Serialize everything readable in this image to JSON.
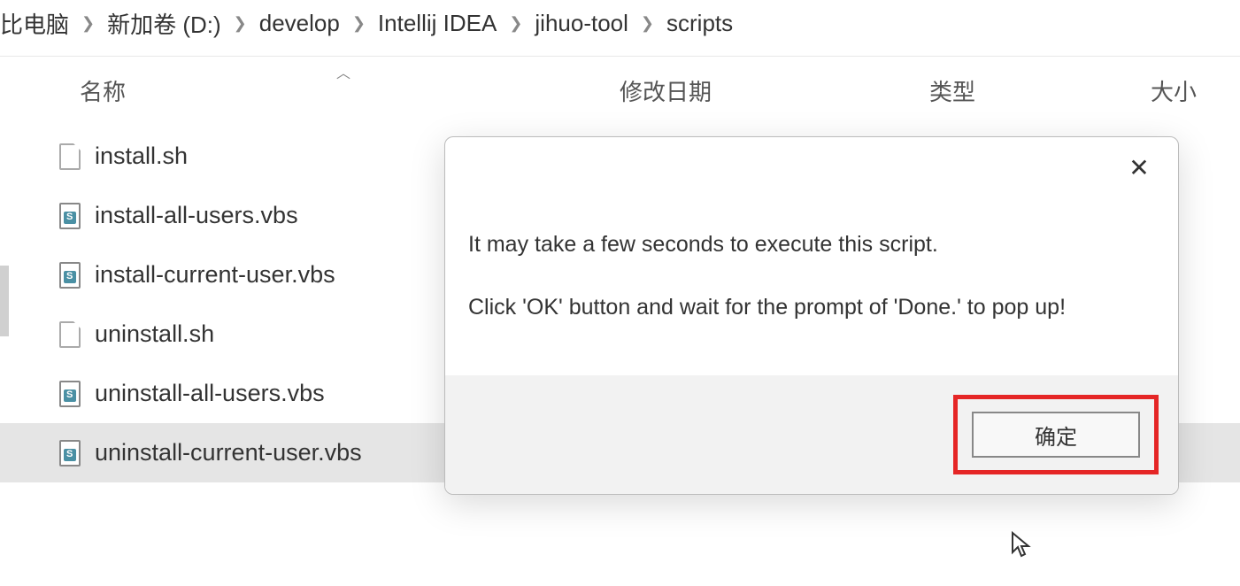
{
  "breadcrumb": {
    "items": [
      "比电脑",
      "新加卷 (D:)",
      "develop",
      "Intellij IDEA",
      "jihuo-tool",
      "scripts"
    ]
  },
  "columns": {
    "name": "名称",
    "date": "修改日期",
    "type": "类型",
    "size": "大小"
  },
  "files": {
    "items": [
      {
        "name": "install.sh",
        "icon": "blank",
        "selected": false
      },
      {
        "name": "install-all-users.vbs",
        "icon": "vbs",
        "selected": false
      },
      {
        "name": "install-current-user.vbs",
        "icon": "vbs",
        "selected": false
      },
      {
        "name": "uninstall.sh",
        "icon": "blank",
        "selected": false
      },
      {
        "name": "uninstall-all-users.vbs",
        "icon": "vbs",
        "selected": false
      },
      {
        "name": "uninstall-current-user.vbs",
        "icon": "vbs",
        "selected": true
      }
    ]
  },
  "dialog": {
    "line1": "It may take a few seconds to execute this script.",
    "line2": "Click 'OK' button and wait for the prompt of 'Done.' to pop up!",
    "ok_label": "确定"
  }
}
